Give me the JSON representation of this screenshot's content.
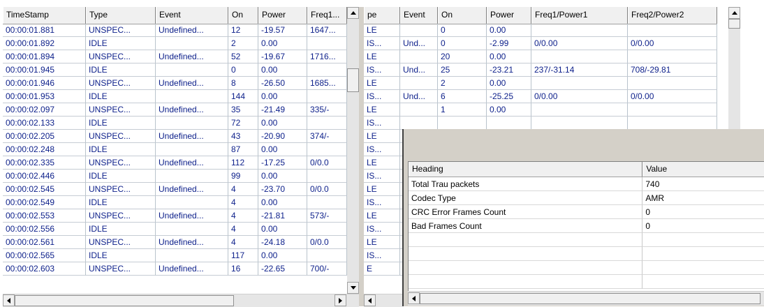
{
  "left_table": {
    "columns": [
      "TimeStamp",
      "Type",
      "Event",
      "On",
      "Power",
      "Freq1..."
    ],
    "rows": [
      [
        "00:00:01.881",
        "UNSPEC...",
        "Undefined...",
        "12",
        "-19.57",
        "1647..."
      ],
      [
        "00:00:01.892",
        "IDLE",
        "",
        "2",
        "0.00",
        ""
      ],
      [
        "00:00:01.894",
        "UNSPEC...",
        "Undefined...",
        "52",
        "-19.67",
        "1716..."
      ],
      [
        "00:00:01.945",
        "IDLE",
        "",
        "0",
        "0.00",
        ""
      ],
      [
        "00:00:01.946",
        "UNSPEC...",
        "Undefined...",
        "8",
        "-26.50",
        "1685..."
      ],
      [
        "00:00:01.953",
        "IDLE",
        "",
        "144",
        "0.00",
        ""
      ],
      [
        "00:00:02.097",
        "UNSPEC...",
        "Undefined...",
        "35",
        "-21.49",
        "335/-"
      ],
      [
        "00:00:02.133",
        "IDLE",
        "",
        "72",
        "0.00",
        ""
      ],
      [
        "00:00:02.205",
        "UNSPEC...",
        "Undefined...",
        "43",
        "-20.90",
        "374/-"
      ],
      [
        "00:00:02.248",
        "IDLE",
        "",
        "87",
        "0.00",
        ""
      ],
      [
        "00:00:02.335",
        "UNSPEC...",
        "Undefined...",
        "112",
        "-17.25",
        "0/0.0"
      ],
      [
        "00:00:02.446",
        "IDLE",
        "",
        "99",
        "0.00",
        ""
      ],
      [
        "00:00:02.545",
        "UNSPEC...",
        "Undefined...",
        "4",
        "-23.70",
        "0/0.0"
      ],
      [
        "00:00:02.549",
        "IDLE",
        "",
        "4",
        "0.00",
        ""
      ],
      [
        "00:00:02.553",
        "UNSPEC...",
        "Undefined...",
        "4",
        "-21.81",
        "573/-"
      ],
      [
        "00:00:02.556",
        "IDLE",
        "",
        "4",
        "0.00",
        ""
      ],
      [
        "00:00:02.561",
        "UNSPEC...",
        "Undefined...",
        "4",
        "-24.18",
        "0/0.0"
      ],
      [
        "00:00:02.565",
        "IDLE",
        "",
        "117",
        "0.00",
        ""
      ],
      [
        "00:00:02.603",
        "UNSPEC...",
        "Undefined...",
        "16",
        "-22.65",
        "700/-"
      ]
    ]
  },
  "right_table": {
    "columns": [
      "pe",
      "Event",
      "On",
      "Power",
      "Freq1/Power1",
      "Freq2/Power2"
    ],
    "rows": [
      [
        "LE",
        "",
        "0",
        "0.00",
        "",
        ""
      ],
      [
        "IS...",
        "Und...",
        "0",
        "-2.99",
        "0/0.00",
        "0/0.00"
      ],
      [
        "LE",
        "",
        "20",
        "0.00",
        "",
        ""
      ],
      [
        "IS...",
        "Und...",
        "25",
        "-23.21",
        "237/-31.14",
        "708/-29.81"
      ],
      [
        "LE",
        "",
        "2",
        "0.00",
        "",
        ""
      ],
      [
        "IS...",
        "Und...",
        "6",
        "-25.25",
        "0/0.00",
        "0/0.00"
      ],
      [
        "LE",
        "",
        "1",
        "0.00",
        "",
        ""
      ],
      [
        "IS...",
        "",
        "",
        "",
        "",
        ""
      ],
      [
        "LE",
        "",
        "",
        "",
        "",
        ""
      ],
      [
        "IS...",
        "",
        "",
        "",
        "",
        ""
      ],
      [
        "LE",
        "",
        "",
        "",
        "",
        ""
      ],
      [
        "IS...",
        "",
        "",
        "",
        "",
        ""
      ],
      [
        "LE",
        "",
        "",
        "",
        "",
        ""
      ],
      [
        "IS...",
        "",
        "",
        "",
        "",
        ""
      ],
      [
        "LE",
        "",
        "",
        "",
        "",
        ""
      ],
      [
        "IS...",
        "",
        "",
        "",
        "",
        ""
      ],
      [
        "LE",
        "",
        "",
        "",
        "",
        ""
      ],
      [
        "IS...",
        "",
        "",
        "",
        "",
        ""
      ],
      [
        "E",
        "",
        "",
        "",
        "",
        ""
      ]
    ]
  },
  "properties": {
    "columns": [
      "Heading",
      "Value"
    ],
    "rows": [
      [
        "Total Trau packets",
        "740"
      ],
      [
        "Codec Type",
        "AMR"
      ],
      [
        "CRC Error Frames Count",
        "0"
      ],
      [
        "Bad Frames Count",
        "0"
      ],
      [
        "",
        ""
      ],
      [
        "",
        ""
      ],
      [
        "",
        ""
      ],
      [
        "",
        ""
      ]
    ]
  }
}
